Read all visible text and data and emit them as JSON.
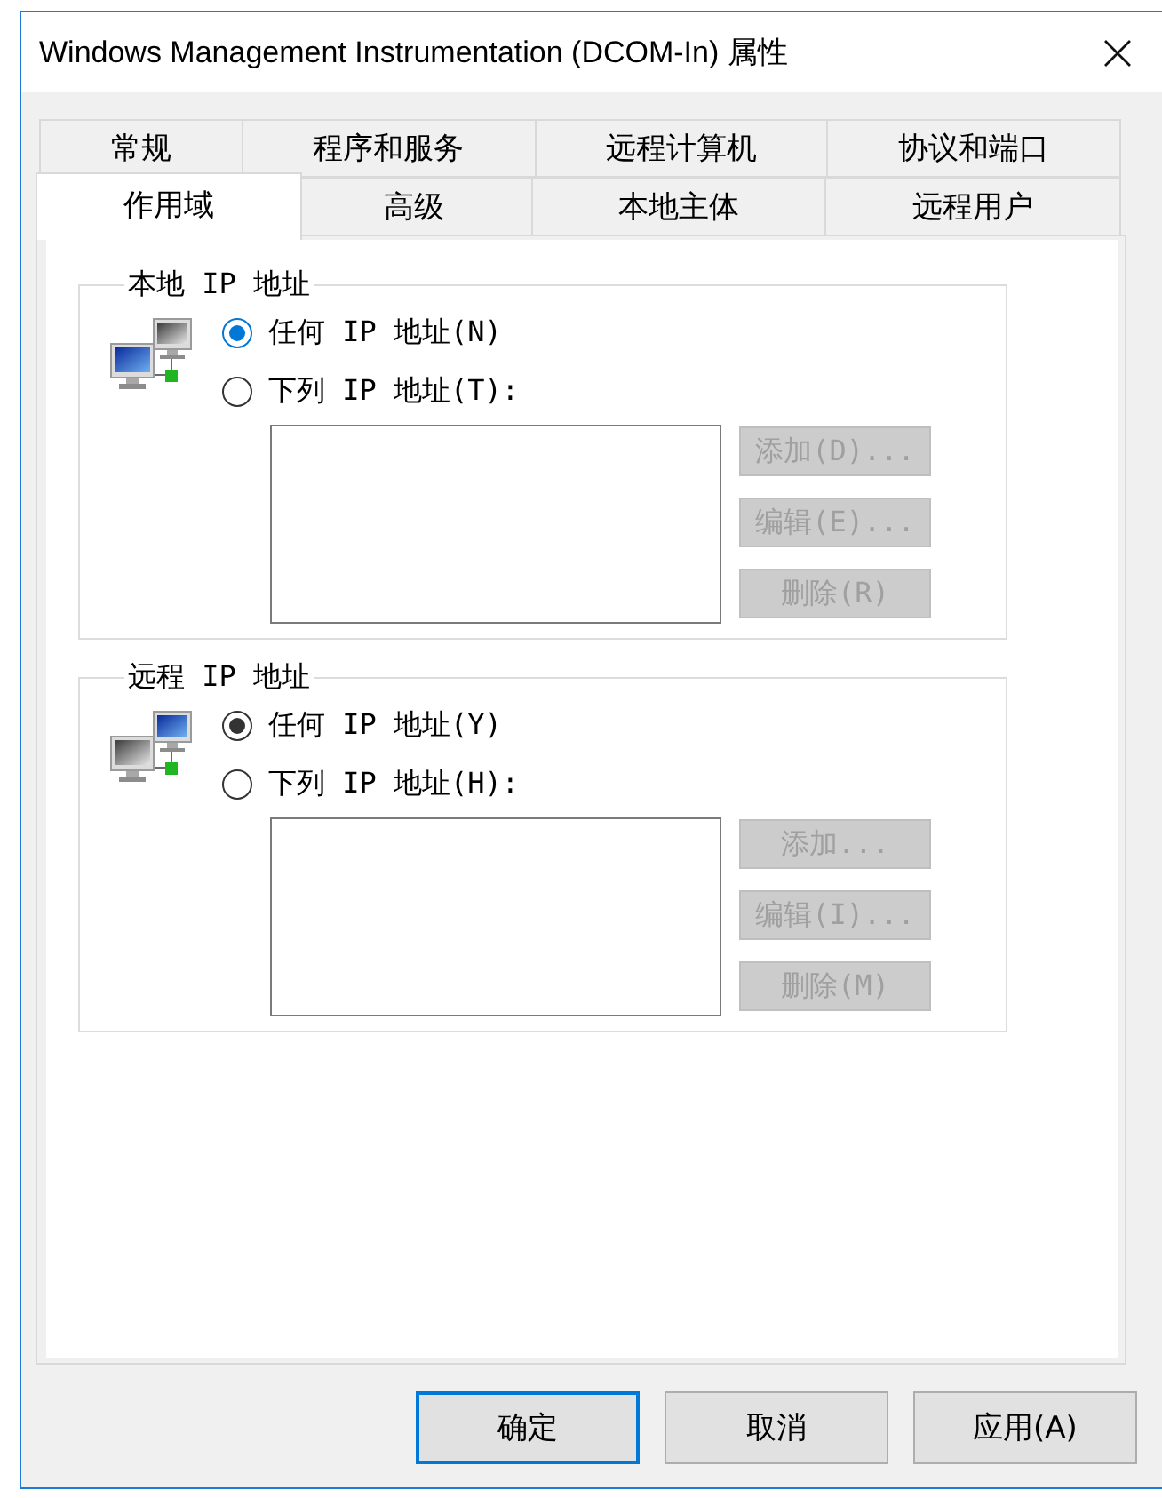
{
  "window": {
    "title": "Windows Management Instrumentation (DCOM-In) 属性"
  },
  "tab_rows": [
    [
      {
        "label": "常规",
        "selected": false
      },
      {
        "label": "程序和服务",
        "selected": false
      },
      {
        "label": "远程计算机",
        "selected": false
      },
      {
        "label": "协议和端口",
        "selected": false
      }
    ],
    [
      {
        "label": "作用域",
        "selected": true
      },
      {
        "label": "高级",
        "selected": false
      },
      {
        "label": "本地主体",
        "selected": false
      },
      {
        "label": "远程用户",
        "selected": false
      }
    ]
  ],
  "groups": [
    {
      "title": "本地 IP 地址",
      "options": [
        {
          "label": "任何 IP 地址(N)",
          "selected": true,
          "color": "#0078d7"
        },
        {
          "label": "下列 IP 地址(T):",
          "selected": false,
          "color": "#333333"
        }
      ],
      "buttons": [
        {
          "label": "添加(D)...",
          "disabled": true
        },
        {
          "label": "编辑(E)...",
          "disabled": true
        },
        {
          "label": "删除(R)",
          "disabled": true
        }
      ]
    },
    {
      "title": "远程 IP 地址",
      "options": [
        {
          "label": "任何 IP 地址(Y)",
          "selected": true,
          "color": "#333333"
        },
        {
          "label": "下列 IP 地址(H):",
          "selected": false,
          "color": "#333333"
        }
      ],
      "buttons": [
        {
          "label": "添加...",
          "disabled": true
        },
        {
          "label": "编辑(I)...",
          "disabled": true
        },
        {
          "label": "删除(M)",
          "disabled": true
        }
      ]
    }
  ],
  "buttons": [
    {
      "label": "确定",
      "default": true
    },
    {
      "label": "取消",
      "default": false
    },
    {
      "label": "应用(A)",
      "default": false
    }
  ]
}
